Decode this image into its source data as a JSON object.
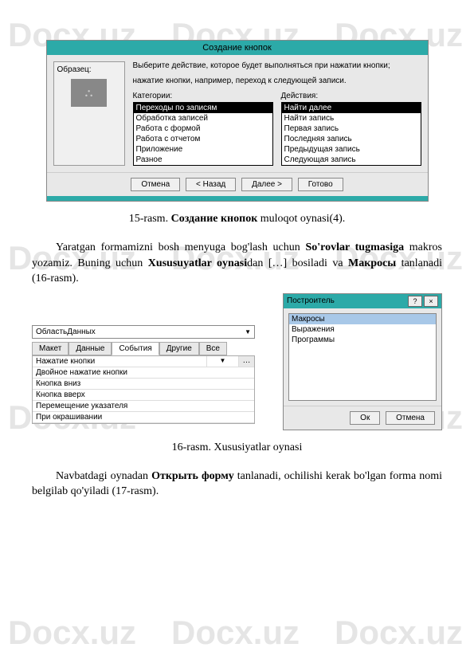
{
  "watermark": "Docx.uz",
  "dialog1": {
    "title": "Создание кнопок",
    "sample_label": "Образец:",
    "instruction1": "Выберите действие, которое будет выполняться при нажатии кнопки;",
    "instruction2": "нажатие кнопки, например, переход к следующей записи.",
    "cat_label": "Категории:",
    "act_label": "Действия:",
    "categories": [
      "Переходы по записям",
      "Обработка записей",
      "Работа с формой",
      "Работа с отчетом",
      "Приложение",
      "Разное"
    ],
    "actions": [
      "Найти далее",
      "Найти запись",
      "Первая запись",
      "Последняя запись",
      "Предыдущая запись",
      "Следующая запись"
    ],
    "buttons": {
      "cancel": "Отмена",
      "back": "< Назад",
      "next": "Далее >",
      "finish": "Готово"
    }
  },
  "caption1_pre": "15-rasm. ",
  "caption1_bold": "Создание кнопок",
  "caption1_post": " muloqot oynasi(4).",
  "para1_pre": "Yaratgan formamizni bosh menyuga bog'lash uchun ",
  "para1_b1": "So'rovlar tugmasiga",
  "para1_mid": " makros yozamiz. Buning uchun ",
  "para1_b2": "Xususuyatlar oynasi",
  "para1_mid2": "dan […] bosiladi va ",
  "para1_b3": "Макросы",
  "para1_end": " tanlanadi (16-rasm).",
  "props": {
    "combo": "ОбластьДанных",
    "tabs": [
      "Макет",
      "Данные",
      "События",
      "Другие",
      "Все"
    ],
    "rows": [
      "Нажатие кнопки",
      "Двойное нажатие кнопки",
      "Кнопка вниз",
      "Кнопка вверх",
      "Перемещение указателя",
      "При окрашивании"
    ]
  },
  "dialog2": {
    "title": "Построитель",
    "items": [
      "Макросы",
      "Выражения",
      "Программы"
    ],
    "ok": "Ок",
    "cancel": "Отмена"
  },
  "caption2": "16-rasm. Xususiyatlar oynasi",
  "para2_pre": "Navbatdagi oynadan ",
  "para2_b": "Открыть форму",
  "para2_end": " tanlanadi, ochilishi kerak bo'lgan forma nomi belgilab qo'yiladi (17-rasm)."
}
